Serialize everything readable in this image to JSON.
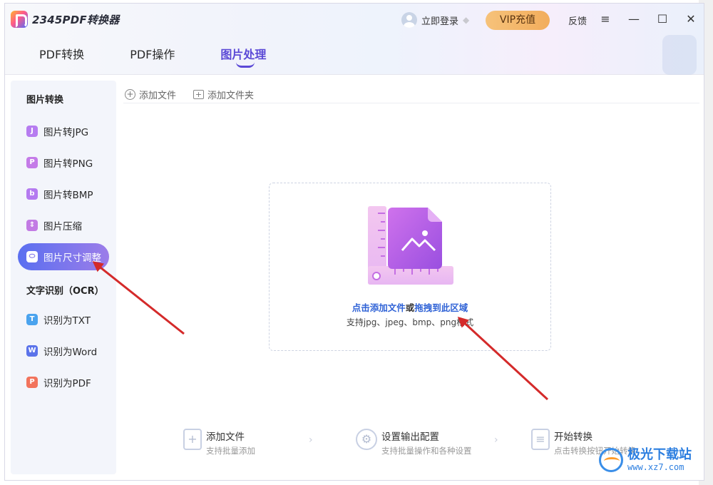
{
  "app": {
    "logo_text": "2345PDF转换器"
  },
  "header": {
    "login_label": "立即登录",
    "vip_label": "VIP充值",
    "feedback_label": "反馈",
    "menu_icon": "≡",
    "minimize_icon": "—",
    "maximize_icon": "☐",
    "close_icon": "✕"
  },
  "tabs": [
    {
      "label": "PDF转换"
    },
    {
      "label": "PDF操作"
    },
    {
      "label": "图片处理"
    }
  ],
  "sidebar": {
    "section1": "图片转换",
    "items1": [
      {
        "label": "图片转JPG",
        "icon": "J",
        "color": "#b67cf0"
      },
      {
        "label": "图片转PNG",
        "icon": "P",
        "color": "#c47be8"
      },
      {
        "label": "图片转BMP",
        "icon": "b",
        "color": "#b47af0"
      },
      {
        "label": "图片压缩",
        "icon": "⇕",
        "color": "#c27ae4"
      },
      {
        "label": "图片尺寸调整",
        "icon": "⬭",
        "color": "#ffffff"
      }
    ],
    "section2": "文字识别（OCR）",
    "items2": [
      {
        "label": "识别为TXT",
        "icon": "T",
        "color": "#4aa3ee"
      },
      {
        "label": "识别为Word",
        "icon": "W",
        "color": "#5b73ea"
      },
      {
        "label": "识别为PDF",
        "icon": "P",
        "color": "#f2735c"
      }
    ]
  },
  "toolbar": {
    "add_file": "添加文件",
    "add_folder": "添加文件夹"
  },
  "dropzone": {
    "click_part": "点击添加文件",
    "or_part": "或",
    "drag_part": "拖拽到此区域",
    "formats": "支持jpg、jpeg、bmp、png格式"
  },
  "steps": [
    {
      "title": "添加文件",
      "desc": "支持批量添加"
    },
    {
      "title": "设置输出配置",
      "desc": "支持批量操作和各种设置"
    },
    {
      "title": "开始转换",
      "desc": "点击转换按钮开始转换"
    }
  ],
  "corner_watermark": {
    "title": "极光下载站",
    "url": "www.xz7.com"
  },
  "colors": {
    "accent": "#5b49d6",
    "annotation_arrow": "#d42a2a"
  }
}
